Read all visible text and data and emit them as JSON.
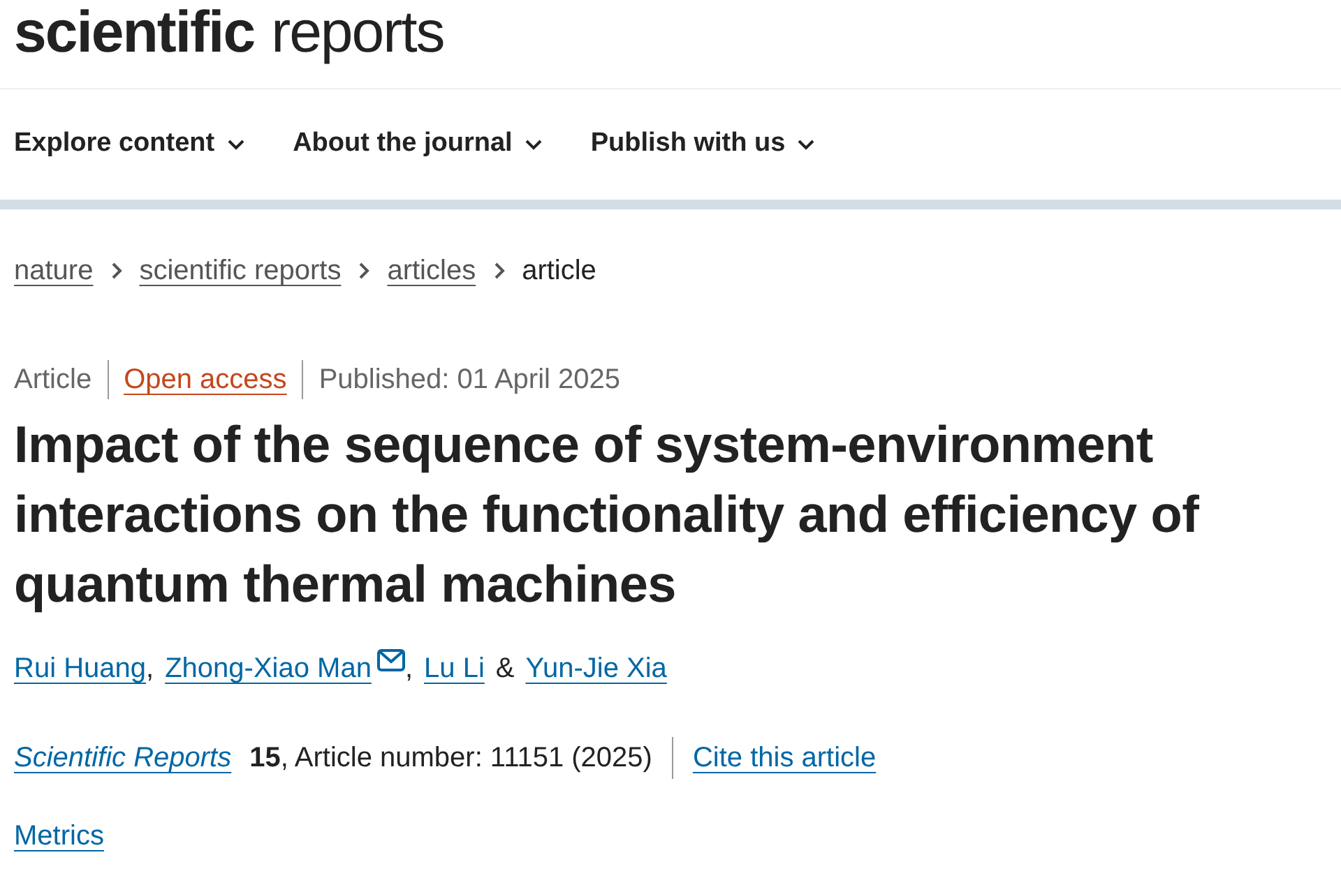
{
  "logo": {
    "bold": "scientific",
    "light": "reports"
  },
  "nav": [
    {
      "label": "Explore content"
    },
    {
      "label": "About the journal"
    },
    {
      "label": "Publish with us"
    }
  ],
  "breadcrumbs": [
    {
      "label": "nature",
      "link": true
    },
    {
      "label": "scientific reports",
      "link": true
    },
    {
      "label": "articles",
      "link": true
    },
    {
      "label": "article",
      "link": false
    }
  ],
  "meta": {
    "type": "Article",
    "access": "Open access",
    "published": "Published: 01 April 2025"
  },
  "title": "Impact of the sequence of system-environment interactions on the functionality and efficiency of quantum thermal machines",
  "authors": [
    {
      "name": "Rui Huang",
      "mail": false,
      "separator": ","
    },
    {
      "name": "Zhong-Xiao Man",
      "mail": true,
      "separator": ","
    },
    {
      "name": "Lu Li",
      "mail": false,
      "separator": "&"
    },
    {
      "name": "Yun-Jie Xia",
      "mail": false
    }
  ],
  "citation": {
    "journal": "Scientific Reports",
    "details": "**15**, Article number: 11151 (2025)",
    "cite": "Cite this article"
  },
  "metrics": "Metrics"
}
